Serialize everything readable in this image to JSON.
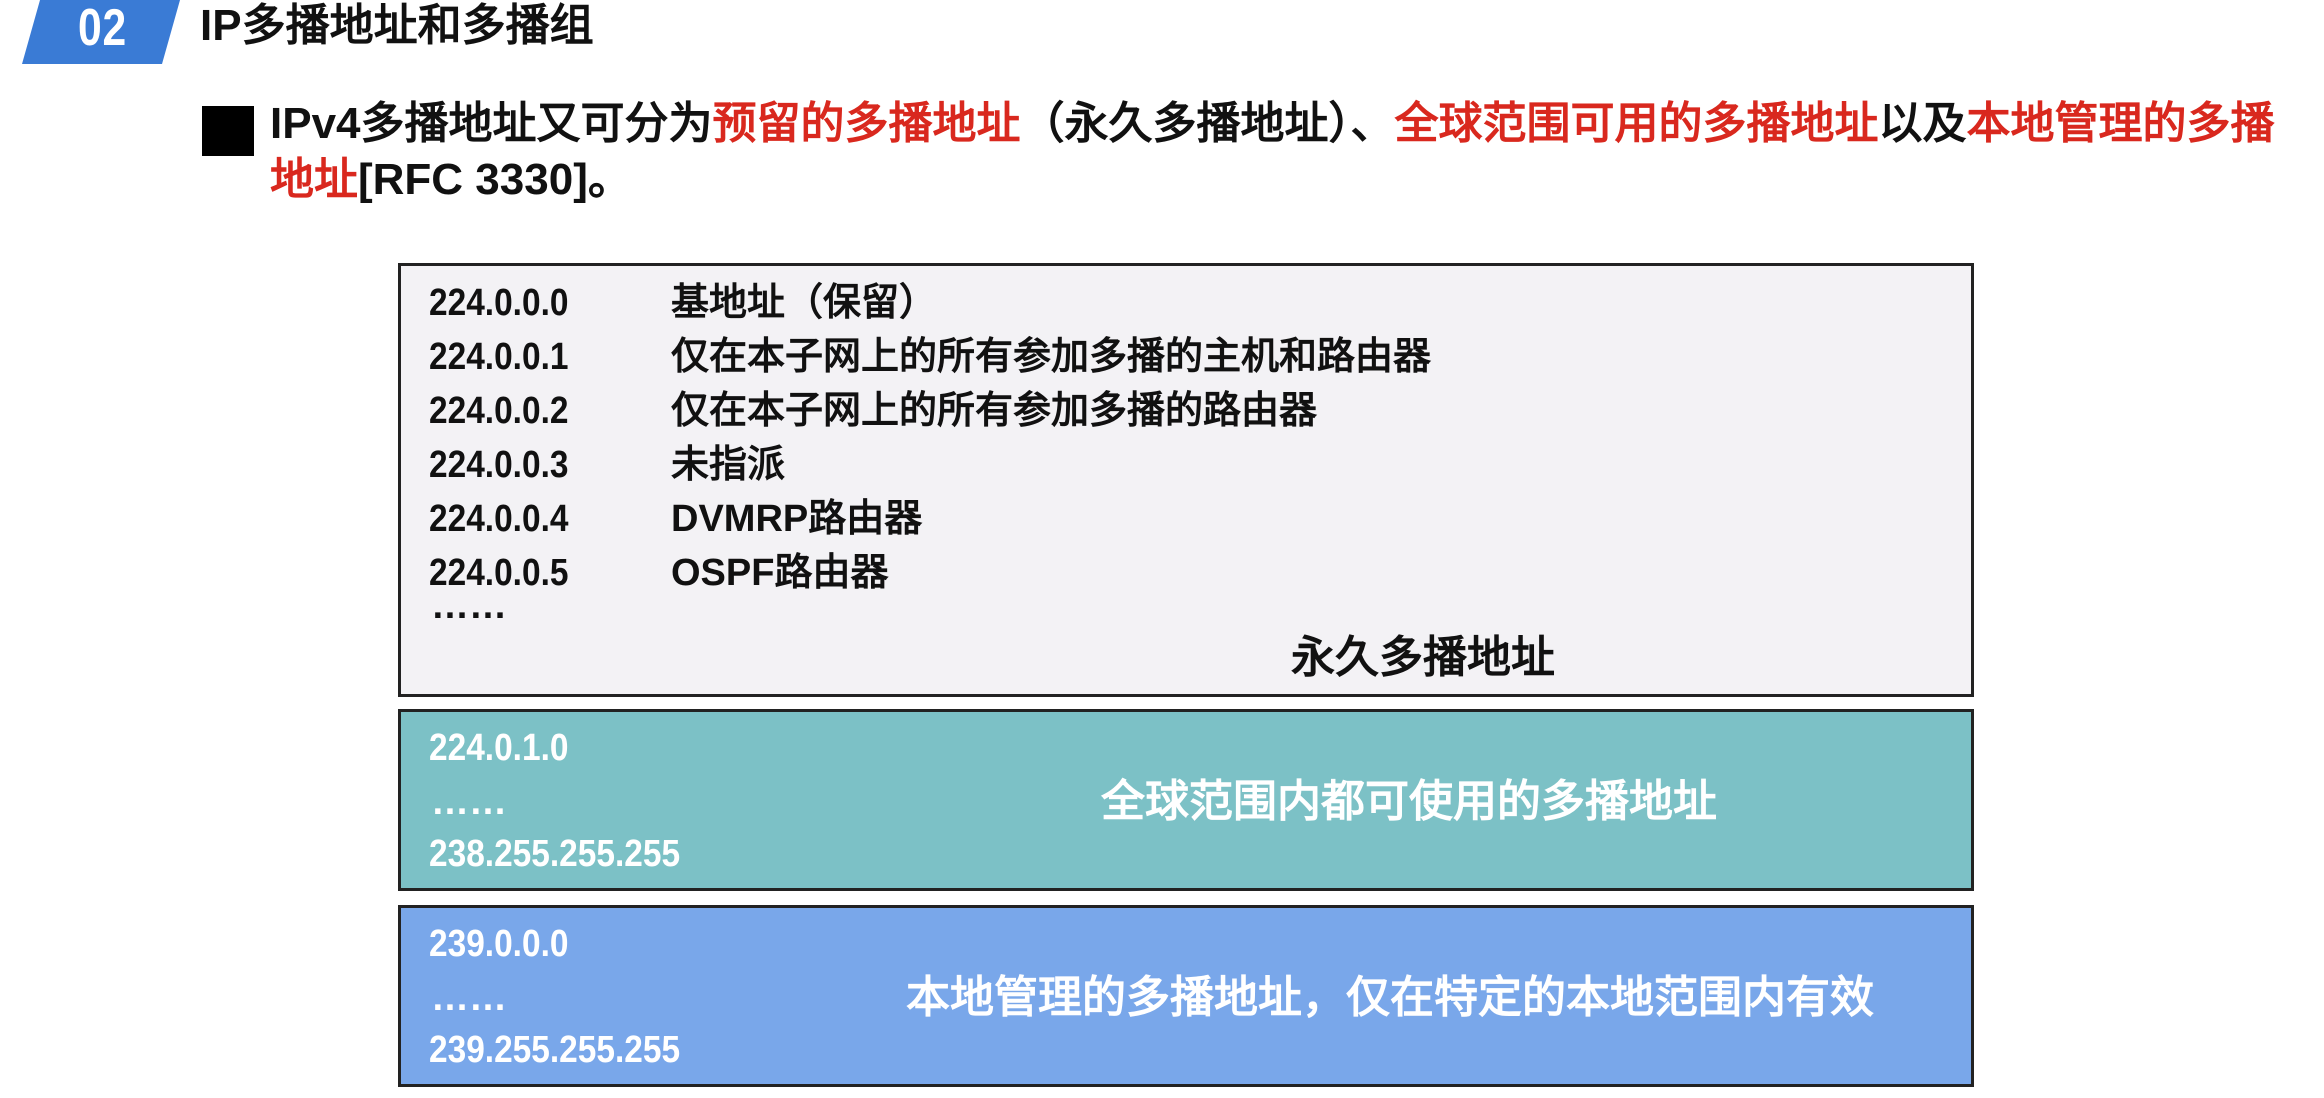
{
  "header": {
    "number": "02",
    "title": "IP多播地址和多播组",
    "badge_color": "#3a7bd5"
  },
  "intro": {
    "part1": "IPv4多播地址又可分为",
    "red1": "预留的多播地址",
    "part2": "（永久多播地址）、",
    "red2": "全球范围可用的多播地址",
    "part3": "以及",
    "red3": "本地管理的多播地址",
    "part4": "[RFC 3330]。",
    "highlight_color": "#d9281e"
  },
  "permanent_box": {
    "rows": [
      {
        "address": "224.0.0.0",
        "description": "基地址（保留）"
      },
      {
        "address": "224.0.0.1",
        "description": "仅在本子网上的所有参加多播的主机和路由器"
      },
      {
        "address": "224.0.0.2",
        "description": "仅在本子网上的所有参加多播的路由器"
      },
      {
        "address": "224.0.0.3",
        "description": "未指派"
      },
      {
        "address": "224.0.0.4",
        "description": "DVMRP路由器"
      },
      {
        "address": "224.0.0.5",
        "description": "OSPF路由器"
      }
    ],
    "ellipsis": "……",
    "label": "永久多播地址",
    "background": "#f3f2f5"
  },
  "global_box": {
    "start": "224.0.1.0",
    "ellipsis": "……",
    "end": "238.255.255.255",
    "label": "全球范围内都可使用的多播地址",
    "background": "#7cc1c6"
  },
  "local_box": {
    "start": "239.0.0.0",
    "ellipsis": "……",
    "end": "239.255.255.255",
    "label": "本地管理的多播地址，仅在特定的本地范围内有效",
    "background": "#79a7ea"
  }
}
